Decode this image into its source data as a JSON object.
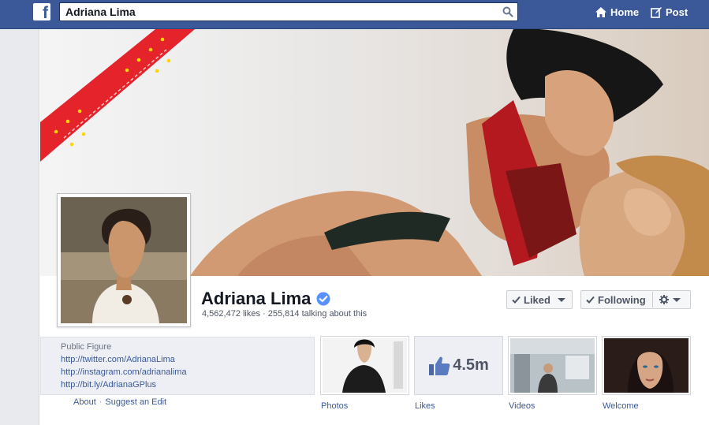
{
  "topbar": {
    "logo": "f",
    "search_value": "Adriana Lima",
    "home_label": "Home",
    "post_label": "Post"
  },
  "page": {
    "name": "Adriana Lima",
    "stats": "4,562,472 likes · 255,814 talking about this",
    "liked_label": "Liked",
    "following_label": "Following"
  },
  "about": {
    "category": "Public Figure",
    "links": [
      "http://twitter.com/AdrianaLima",
      "http://instagram.com/adrianalima",
      "http://bit.ly/AdrianaGPlus"
    ],
    "about_label": "About",
    "suggest_label": "Suggest an Edit"
  },
  "apps": [
    {
      "label": "Photos"
    },
    {
      "label": "Likes",
      "count": "4.5m"
    },
    {
      "label": "Videos"
    },
    {
      "label": "Welcome"
    }
  ],
  "colors": {
    "brand": "#3b5998",
    "verified": "#5890ff",
    "cover_banner": "#e4232b"
  }
}
